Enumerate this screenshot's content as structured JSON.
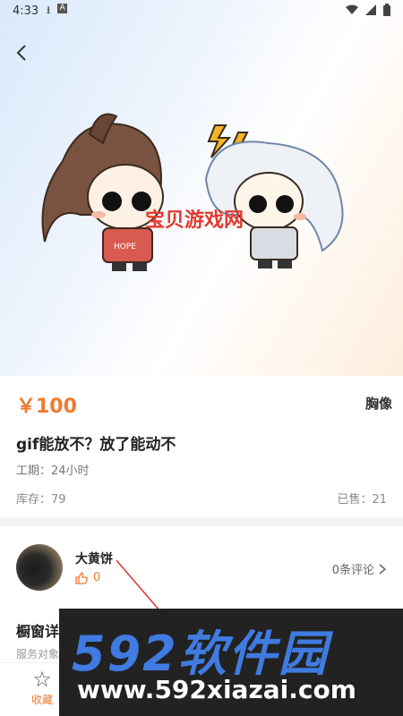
{
  "status_bar": {
    "time": "4:33",
    "left_icons": [
      "download-icon",
      "a-badge-icon"
    ],
    "right_icons": [
      "wifi-icon",
      "signal-icon",
      "battery-icon"
    ]
  },
  "product": {
    "price": "￥100",
    "category": "胸像",
    "title": "gif能放不？放了能动不",
    "duration": "工期：24小时",
    "stock": "库存：79",
    "sold": "已售：21"
  },
  "watermark": {
    "center_text": "宝贝游戏网",
    "banner_logo": "592软件园",
    "banner_url": "www.592xiazai.com"
  },
  "author": {
    "name": "大黄饼",
    "likes": "0",
    "comments": "0条评论"
  },
  "section": {
    "title": "橱窗详",
    "sub": "服务对象说明"
  },
  "bottom_bar": {
    "favorite_label": "收藏"
  },
  "colors": {
    "accent": "#f07a2f",
    "watermark_red": "#e23a2e",
    "banner_blue": "#3f7be0"
  }
}
